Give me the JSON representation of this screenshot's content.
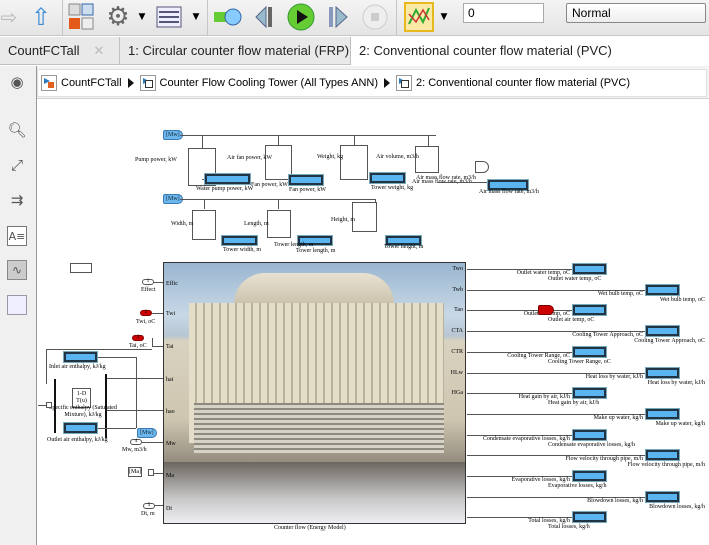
{
  "toolbar": {
    "sim_time": "0",
    "sim_mode": "Normal",
    "icons": [
      "forward-icon",
      "up-icon",
      "library-icon",
      "gear-icon",
      "model-config-icon",
      "update-icon",
      "step-back-icon",
      "run-icon",
      "step-forward-icon",
      "stop-icon",
      "data-inspector-icon"
    ]
  },
  "tabs": [
    {
      "label": "CountFCTall"
    },
    {
      "label": "1: Circular counter flow material (FRP) (6-800 Ton/h)"
    },
    {
      "label": "2: Conventional counter flow material (PVC)"
    }
  ],
  "breadcrumb": [
    "CountFCTall",
    "Counter Flow Cooling Tower (All Types ANN)",
    "2: Conventional counter flow material (PVC)"
  ],
  "sidebar": [
    "back-icon",
    "zoom-in-icon",
    "fit-view-icon",
    "arrows-icon",
    "annotation-icon",
    "image-icon",
    "box-icon"
  ],
  "diagram": {
    "goto_mw": "[Mw]",
    "goto_ma": "[Ma]",
    "top_row": [
      {
        "in": "Pump power, kW",
        "out": "Water pump power, kW"
      },
      {
        "in": "Air fan power, kW",
        "mid": "Fan power, kW",
        "out": "Fan power, kW"
      },
      {
        "in": "Weight, kg",
        "out": "Tower weight, kg"
      },
      {
        "in": "Air volume, m3/h",
        "mid": "Air mass flow rate, m3/h",
        "mid2": "Air mass flow rate, m3/h",
        "out": "Air mass flow rate, m3/h"
      }
    ],
    "second_row": [
      {
        "in": "Width, m",
        "out": "Tower width, m"
      },
      {
        "in": "Length, m",
        "mid": "Tower length, m",
        "out": "Tower length, m"
      },
      {
        "in": "Height, m",
        "out": "Tower height, m"
      }
    ],
    "inputs": [
      {
        "num": "1",
        "label": "Effect",
        "port": "Effic"
      },
      {
        "num": "2",
        "label": "Twi, oC",
        "port": "Twi"
      },
      {
        "num": "3",
        "label": "Tai, oC",
        "port": "Tai"
      },
      {
        "num": "4",
        "label": "Mw, m3/h",
        "port": "Mw"
      },
      {
        "num": "5",
        "label": "Dt, m",
        "port": "Dt"
      }
    ],
    "inlet_enthalpy": "Inlet air enthalpy, kJ/kg",
    "lookup_label": "1-D T(u)",
    "specific_enthalpy": "Specific enthalpy (Saturated Mixture), kJ/kg",
    "outlet_enthalpy": "Outlet air enthalpy, kJ/kg",
    "left_ports": [
      "hai",
      "hao",
      "Ma"
    ],
    "right_ports": [
      "Two",
      "Twb",
      "Tao",
      "CTA",
      "CTR",
      "HLw",
      "HGa"
    ],
    "main_block": "Counter flow (Energy Model)",
    "outputs": [
      {
        "line": "Outlet water temp, oC",
        "display": "Outlet water temp, oC"
      },
      {
        "line": "Wet bulb temp, oC",
        "display": "Wet bulb temp, oC"
      },
      {
        "line": "Outlet air temp, oC",
        "display": "Outlet air temp, oC"
      },
      {
        "line": "Cooling Tower Approach, oC",
        "display": "Cooling Tower Approach, oC"
      },
      {
        "line": "Cooling Tower Range, oC",
        "display": "Cooling Tower Range, oC"
      },
      {
        "line": "Heat loss by water, kJ/h",
        "display": "Heat loss by water, kJ/h"
      },
      {
        "line": "Heat gain by air, kJ/h",
        "display": "Heat gain by air, kJ/h"
      },
      {
        "line": "Make up water, kg/h",
        "display": "Make up water, kg/h"
      },
      {
        "line": "Condensate evaporative losses, kg/h",
        "display": "Condensate evaporative losses, kg/h"
      },
      {
        "line": "Flow velocity through pipe, m/h",
        "display": "Flow velocity through pipe, m/h"
      },
      {
        "line": "Evaporative losses, kg/h",
        "display": "Evaporative losses, kg/h"
      },
      {
        "line": "Blowdown losses, kg/h",
        "display": "Blowdown losses, kg/h"
      },
      {
        "line": "Total losses, kg/h",
        "display": "Total losses, kg/h"
      }
    ],
    "colors": {
      "display": "#5ab4f0",
      "goto": "#6cb8ee",
      "red_port": "#cc0000"
    }
  }
}
